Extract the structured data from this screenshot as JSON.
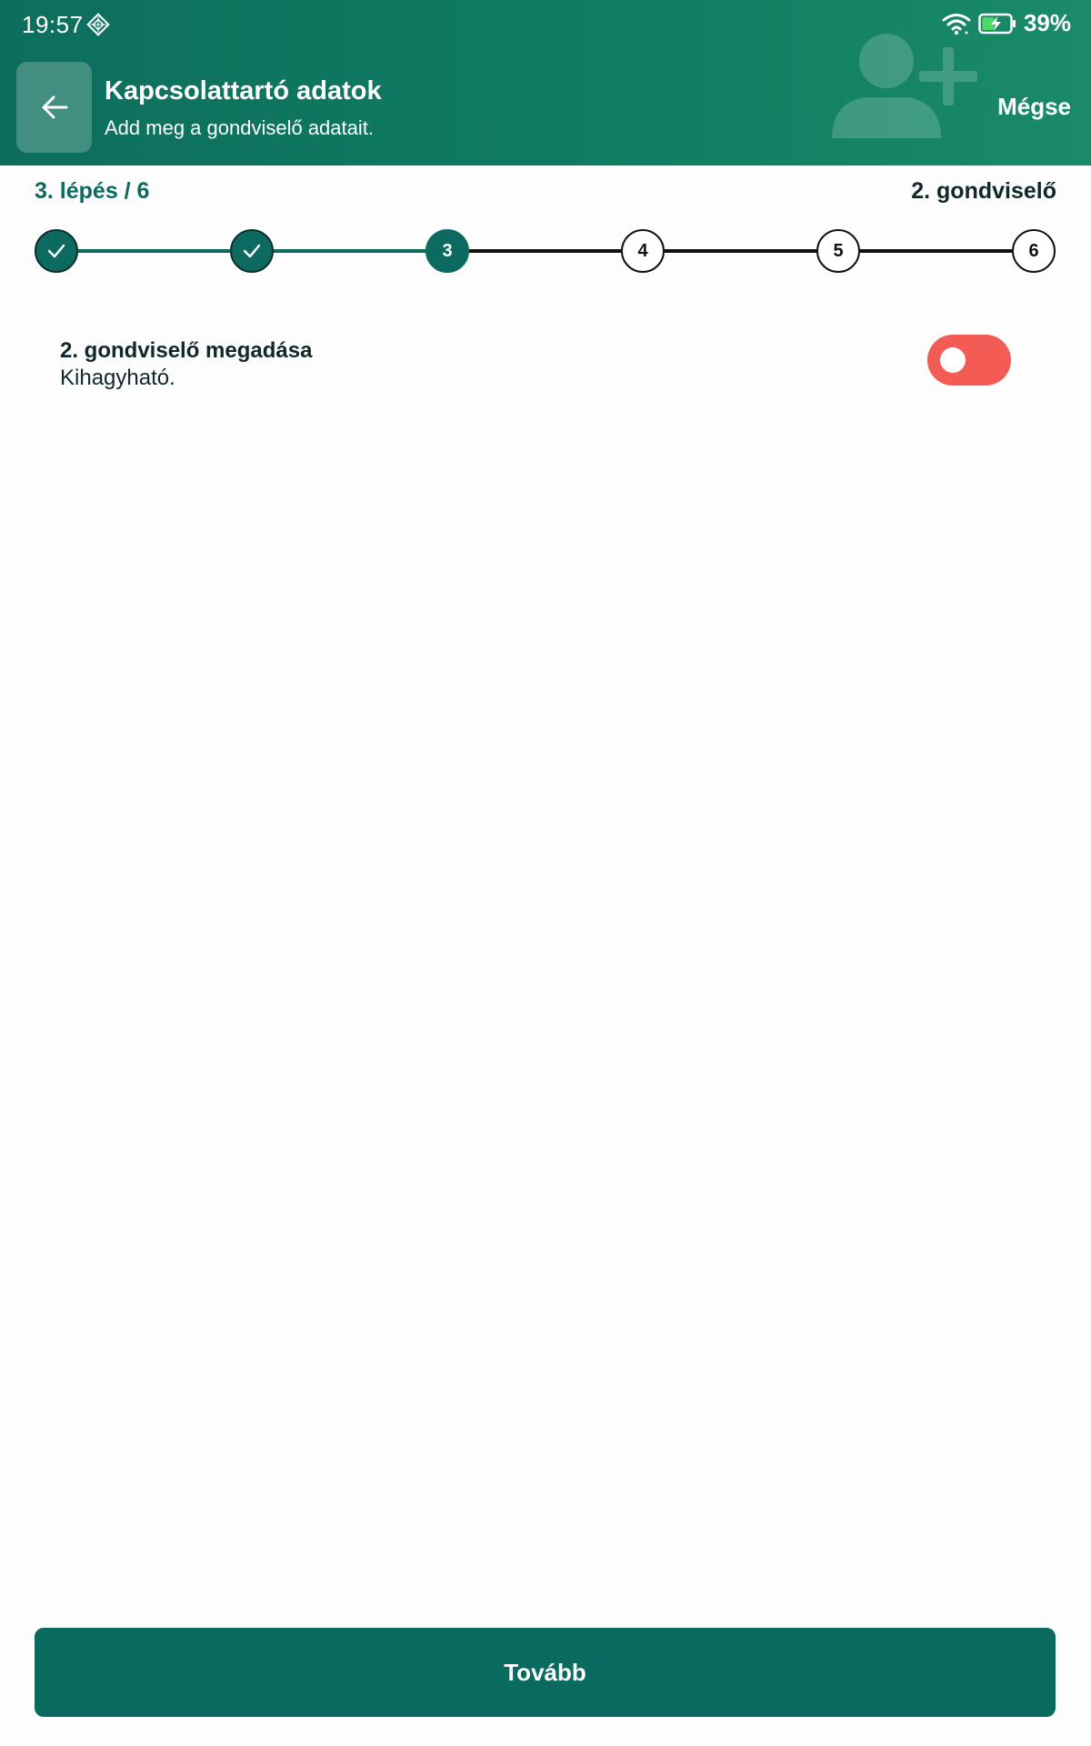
{
  "status_bar": {
    "time": "19:57",
    "battery_percent": "39%",
    "icons": [
      "diamond-notification-icon",
      "wifi-icon",
      "battery-charging-icon"
    ]
  },
  "header": {
    "title": "Kapcsolattartó adatok",
    "subtitle": "Add meg a gondviselő adatait.",
    "cancel_label": "Mégse",
    "back_icon": "arrow-left-icon",
    "illustration_icon": "add-person-icon"
  },
  "progress": {
    "step_label": "3. lépés / 6",
    "step_name": "2. gondviselő",
    "current_step": 3,
    "total_steps": 6,
    "steps": [
      {
        "label": "",
        "state": "done"
      },
      {
        "label": "",
        "state": "done"
      },
      {
        "label": "3",
        "state": "current"
      },
      {
        "label": "4",
        "state": "todo"
      },
      {
        "label": "5",
        "state": "todo"
      },
      {
        "label": "6",
        "state": "todo"
      }
    ]
  },
  "toggle": {
    "title": "2. gondviselő megadása",
    "subtitle": "Kihagyható.",
    "state": "off"
  },
  "footer": {
    "next_label": "Tovább"
  },
  "colors": {
    "primary": "#0c6a60",
    "header_gradient_start": "#0d6e5d",
    "header_gradient_end": "#1a8a68",
    "toggle_off": "#f35b55",
    "step_todo_border": "#111111"
  }
}
